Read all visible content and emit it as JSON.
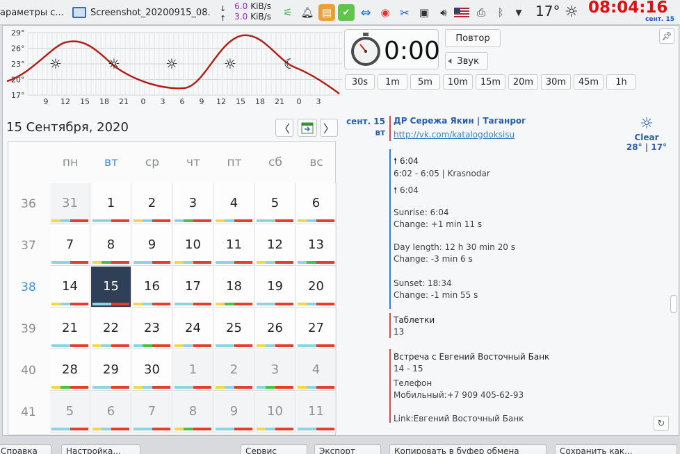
{
  "taskbar": {
    "task1_label": "араметры с...",
    "task2_label": "Screenshot_20200915_08...",
    "net_down": "6.0",
    "net_up": "3.0",
    "net_unit": "KiB/s",
    "temperature": "17°",
    "clock": "08:04:16",
    "clock_date": "сент. 15"
  },
  "weather_graph": {
    "y_ticks": [
      "29°",
      "26°",
      "23°",
      "20°",
      "17°"
    ],
    "x_ticks": [
      "9",
      "12",
      "15",
      "18",
      "21",
      "0",
      "3",
      "6",
      "9",
      "12",
      "15",
      "18",
      "21",
      "0",
      "3"
    ]
  },
  "timer": {
    "value": "0:00",
    "repeat_label": "Повтор",
    "sound_label": "Звук",
    "durations": [
      "30s",
      "1m",
      "5m",
      "10m",
      "15m",
      "20m",
      "30m",
      "45m",
      "1h"
    ]
  },
  "calendar": {
    "title": "15 Сентября, 2020",
    "days_of_week": [
      "пн",
      "вт",
      "ср",
      "чт",
      "пт",
      "сб",
      "вс"
    ],
    "weeks": [
      {
        "num": "36",
        "days": [
          "31",
          "1",
          "2",
          "3",
          "4",
          "5",
          "6"
        ]
      },
      {
        "num": "37",
        "days": [
          "7",
          "8",
          "9",
          "10",
          "11",
          "12",
          "13"
        ]
      },
      {
        "num": "38",
        "days": [
          "14",
          "15",
          "16",
          "17",
          "18",
          "19",
          "20"
        ]
      },
      {
        "num": "39",
        "days": [
          "21",
          "22",
          "23",
          "24",
          "25",
          "26",
          "27"
        ]
      },
      {
        "num": "40",
        "days": [
          "28",
          "29",
          "30",
          "1",
          "2",
          "3",
          "4"
        ]
      },
      {
        "num": "41",
        "days": [
          "5",
          "6",
          "7",
          "8",
          "9",
          "10",
          "11"
        ]
      }
    ]
  },
  "events": {
    "date_day": "сент. 15",
    "date_weekday": "вт",
    "event1_title": "ДР Сережа Якин | Таганрог",
    "event1_link": "http://vk.com/katalogdoksisu",
    "sunrise_time": "6:04",
    "twilight": "6:02 - 6:05 | Krasnodar",
    "sunrise_time2": "6:04",
    "sunrise_line": "Sunrise: 6:04",
    "sunrise_change": "Change: +1 min 11 s",
    "day_length": "Day length: 12 h 30 min 20 s",
    "day_change": "Change: -3 min 6 s",
    "sunset_line": "Sunset: 18:34",
    "sunset_change": "Change: -1 min 55 s",
    "event2_title": "Таблетки",
    "event2_count": "13",
    "event3_title": "Встреча с Евгений Восточный Банк",
    "event3_time": "14 - 15",
    "event3_phone_label": "Телефон",
    "event3_phone": "Мобильный:+7 909 405-62-93",
    "event3_link": "Link:Евгений Восточный Банк"
  },
  "weather_now": {
    "condition": "Clear",
    "temps": "28° | 17°"
  },
  "bottom_buttons": [
    "Справка",
    "Настройка...",
    "Сервис",
    "Экспорт",
    "Копировать в буфер обмена",
    "Сохранить как..."
  ]
}
